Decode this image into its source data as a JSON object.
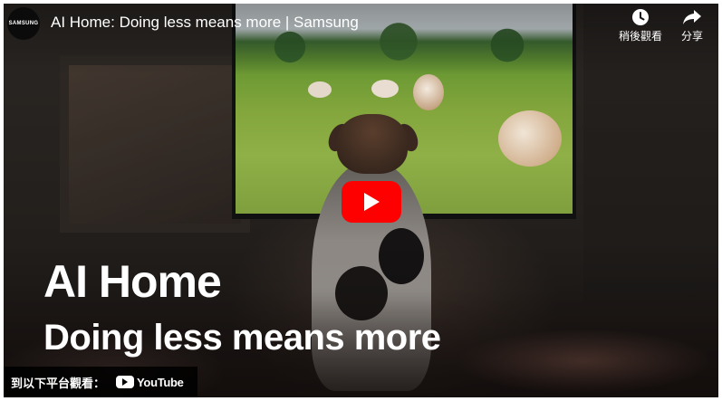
{
  "player": {
    "channel_logo_text": "SAMSUNG",
    "title": "AI Home: Doing less means more | Samsung",
    "actions": {
      "watch_later_label": "稍後觀看",
      "share_label": "分享"
    },
    "overlay": {
      "line1": "AI Home",
      "line2": "Doing less means more"
    },
    "watch_on": {
      "label": "到以下平台觀看：",
      "platform": "YouTube"
    },
    "colors": {
      "play_button": "#ff0000",
      "text": "#ffffff"
    },
    "icons": [
      "clock-icon",
      "share-arrow-icon",
      "play-icon",
      "youtube-logo-icon"
    ]
  }
}
